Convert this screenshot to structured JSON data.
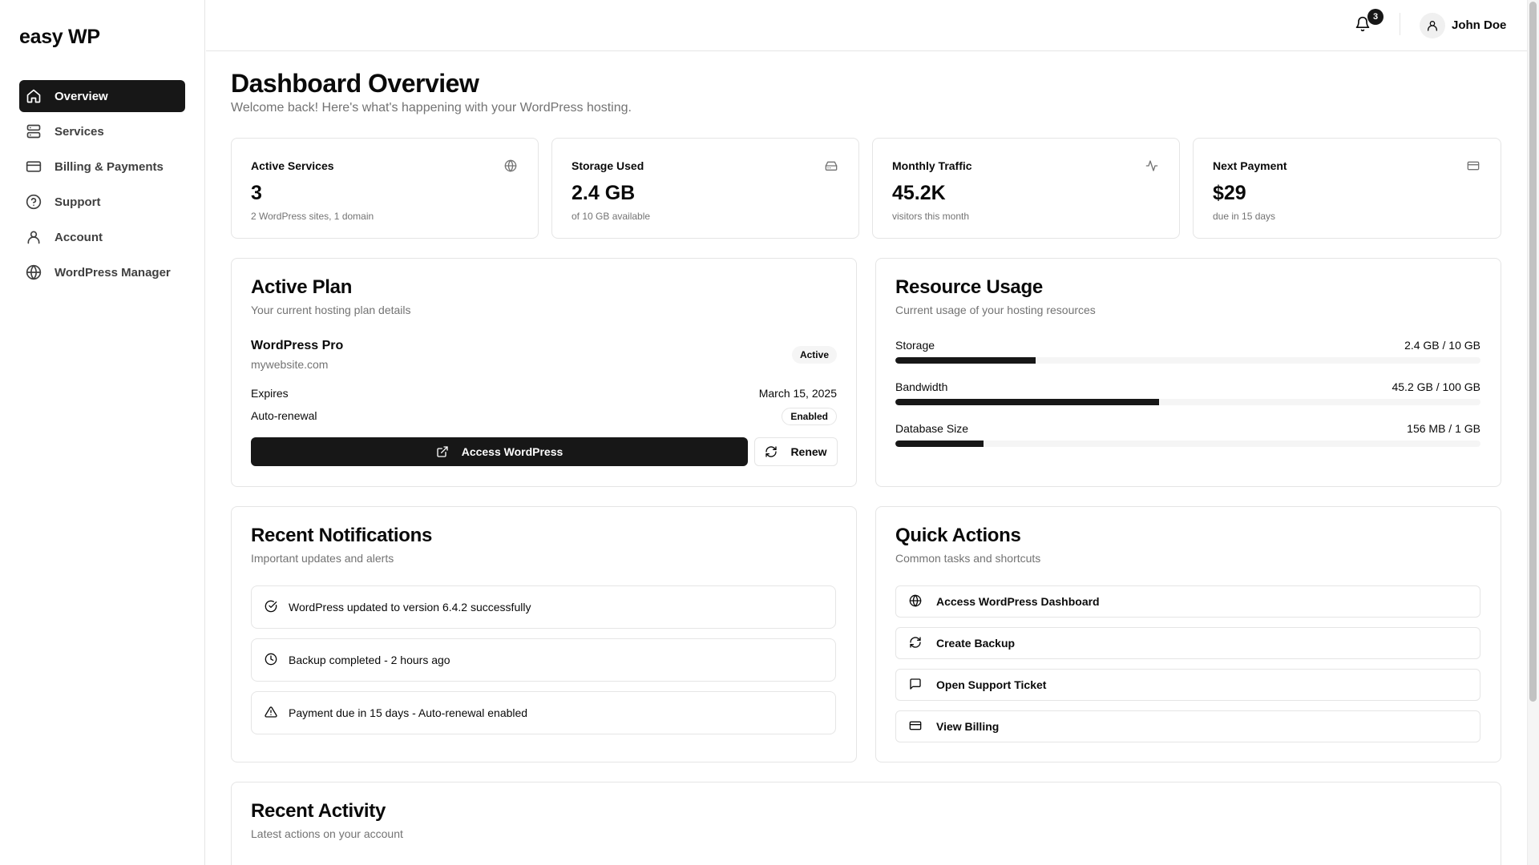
{
  "brand": "easy WP",
  "sidebar": {
    "items": [
      {
        "label": "Overview",
        "icon": "home-icon",
        "active": true
      },
      {
        "label": "Services",
        "icon": "server-icon"
      },
      {
        "label": "Billing & Payments",
        "icon": "credit-card-icon"
      },
      {
        "label": "Support",
        "icon": "help-circle-icon"
      },
      {
        "label": "Account",
        "icon": "user-icon"
      },
      {
        "label": "WordPress Manager",
        "icon": "globe-icon"
      }
    ]
  },
  "header": {
    "notification_count": "3",
    "user_name": "John Doe"
  },
  "page": {
    "title": "Dashboard Overview",
    "subtitle": "Welcome back! Here's what's happening with your WordPress hosting."
  },
  "stats": [
    {
      "label": "Active Services",
      "value": "3",
      "note": "2 WordPress sites, 1 domain",
      "icon": "globe-icon"
    },
    {
      "label": "Storage Used",
      "value": "2.4 GB",
      "note": "of 10 GB available",
      "icon": "hard-drive-icon"
    },
    {
      "label": "Monthly Traffic",
      "value": "45.2K",
      "note": "visitors this month",
      "icon": "activity-icon"
    },
    {
      "label": "Next Payment",
      "value": "$29",
      "note": "due in 15 days",
      "icon": "credit-card-icon"
    }
  ],
  "active_plan": {
    "title": "Active Plan",
    "description": "Your current hosting plan details",
    "plan_name": "WordPress Pro",
    "domain": "mywebsite.com",
    "status": "Active",
    "expires_label": "Expires",
    "expires_value": "March 15, 2025",
    "autorenew_label": "Auto-renewal",
    "autorenew_value": "Enabled",
    "access_button": "Access WordPress",
    "renew_button": "Renew"
  },
  "resource_usage": {
    "title": "Resource Usage",
    "description": "Current usage of your hosting resources",
    "items": [
      {
        "label": "Storage",
        "value": "2.4 GB / 10 GB",
        "percent": 24
      },
      {
        "label": "Bandwidth",
        "value": "45.2 GB / 100 GB",
        "percent": 45
      },
      {
        "label": "Database Size",
        "value": "156 MB / 1 GB",
        "percent": 15
      }
    ]
  },
  "notifications": {
    "title": "Recent Notifications",
    "description": "Important updates and alerts",
    "items": [
      {
        "text": "WordPress updated to version 6.4.2 successfully",
        "icon": "check-circle-icon"
      },
      {
        "text": "Backup completed - 2 hours ago",
        "icon": "clock-icon"
      },
      {
        "text": "Payment due in 15 days - Auto-renewal enabled",
        "icon": "alert-triangle-icon"
      }
    ]
  },
  "quick_actions": {
    "title": "Quick Actions",
    "description": "Common tasks and shortcuts",
    "items": [
      {
        "label": "Access WordPress Dashboard",
        "icon": "globe-icon"
      },
      {
        "label": "Create Backup",
        "icon": "refresh-icon"
      },
      {
        "label": "Open Support Ticket",
        "icon": "message-square-icon"
      },
      {
        "label": "View Billing",
        "icon": "credit-card-icon"
      }
    ]
  },
  "recent_activity": {
    "title": "Recent Activity",
    "description": "Latest actions on your account"
  }
}
